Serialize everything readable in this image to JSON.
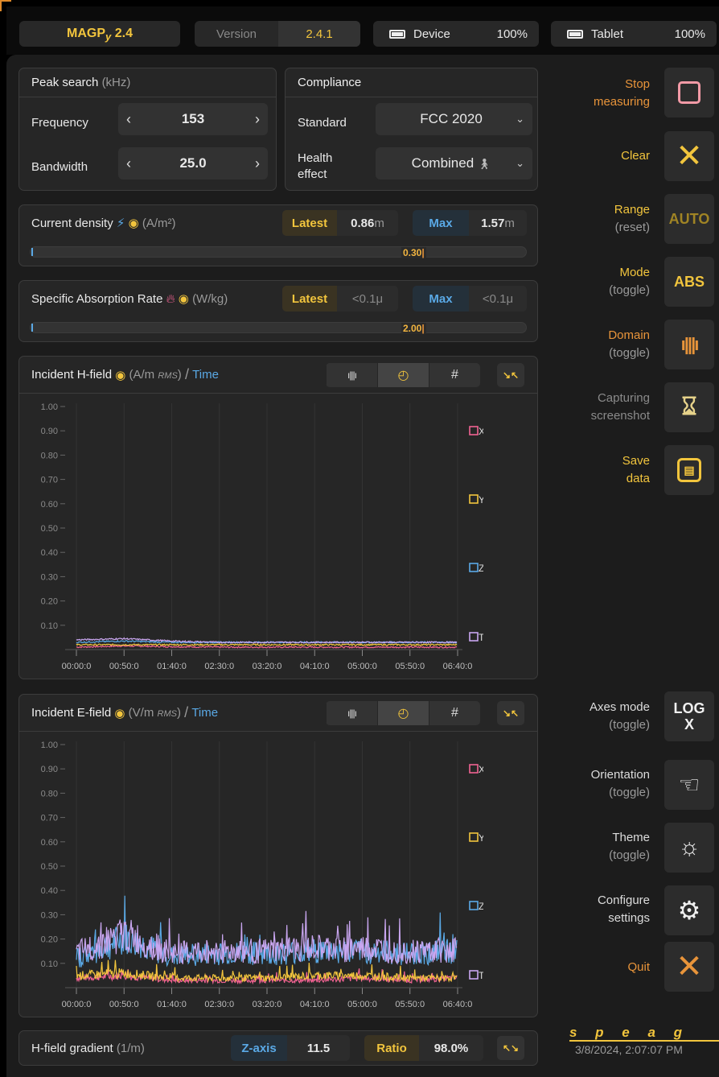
{
  "topbar": {
    "app_name": "MAGPy 2.4",
    "app_name_main": "MAGP",
    "app_name_sub": "y",
    "app_name_ver": "2.4",
    "version_label": "Version",
    "version_value": "2.4.1",
    "device_label": "Device",
    "device_battery": "100%",
    "tablet_label": "Tablet",
    "tablet_battery": "100%"
  },
  "peak_search": {
    "title": "Peak search",
    "unit": "(kHz)",
    "frequency_label": "Frequency",
    "frequency_value": "153",
    "bandwidth_label": "Bandwidth",
    "bandwidth_value": "25.0"
  },
  "compliance": {
    "title": "Compliance",
    "standard_label": "Standard",
    "standard_value": "FCC 2020",
    "health_label_1": "Health",
    "health_label_2": "effect",
    "health_value": "Combined"
  },
  "current_density": {
    "title": "Current density",
    "unit": "(A/m²)",
    "latest_label": "Latest",
    "latest_value": "0.86",
    "latest_suffix": "m",
    "max_label": "Max",
    "max_value": "1.57",
    "max_suffix": "m",
    "limit_value": "0.30",
    "level_fraction": 0.0
  },
  "sar": {
    "title": "Specific Absorption Rate",
    "unit": "(W/kg)",
    "latest_label": "Latest",
    "latest_value": "<0.1μ",
    "max_label": "Max",
    "max_value": "<0.1μ",
    "limit_value": "2.00",
    "level_fraction": 0.0
  },
  "h_field": {
    "title": "Incident H-field",
    "unit_open": "(A/m",
    "unit_rms": "RMS",
    "unit_close": ")",
    "slash": "/",
    "mode": "Time"
  },
  "e_field": {
    "title": "Incident E-field",
    "unit_open": "(V/m",
    "unit_rms": "RMS",
    "unit_close": ")",
    "slash": "/",
    "mode": "Time"
  },
  "view_buttons": {
    "hash": "#"
  },
  "gradient": {
    "title": "H-field gradient",
    "unit": "(1/m)",
    "zaxis_label": "Z-axis",
    "zaxis_value": "11.5",
    "ratio_label": "Ratio",
    "ratio_value": "98.0%"
  },
  "right_panel": {
    "stop_1": "Stop",
    "stop_2": "measuring",
    "clear": "Clear",
    "range_1": "Range",
    "range_2": "(reset)",
    "range_button": "AUTO",
    "mode_1": "Mode",
    "mode_2": "(toggle)",
    "mode_button": "ABS",
    "domain_1": "Domain",
    "domain_2": "(toggle)",
    "capture_1": "Capturing",
    "capture_2": "screenshot",
    "save_1": "Save",
    "save_2": "data",
    "axes_1": "Axes mode",
    "axes_2": "(toggle)",
    "axes_button_1": "LOG",
    "axes_button_2": "X",
    "orient_1": "Orientation",
    "orient_2": "(toggle)",
    "theme_1": "Theme",
    "theme_2": "(toggle)",
    "config_1": "Configure",
    "config_2": "settings",
    "quit": "Quit"
  },
  "footer": {
    "logo": "s p e a g",
    "timestamp": "3/8/2024, 2:07:07 PM"
  },
  "colors": {
    "x": "#f06292",
    "y": "#f2c53d",
    "z": "#5aa9e6",
    "total": "#c9a6f0",
    "accent": "#f2c53d",
    "blue": "#5aa9e6",
    "orange": "#e8943a"
  },
  "chart_data": [
    {
      "type": "line",
      "title": "Incident H-field (A/m RMS) / Time",
      "ylim": [
        0,
        1.0
      ],
      "yticks": [
        "1.00",
        "0.90",
        "0.80",
        "0.70",
        "0.60",
        "0.50",
        "0.40",
        "0.30",
        "0.20",
        "0.10"
      ],
      "xticks": [
        "00:00:0",
        "00:50:0",
        "01:40:0",
        "02:30:0",
        "03:20:0",
        "04:10:0",
        "05:00:0",
        "05:50:0",
        "06:40:0"
      ],
      "legend": [
        "X",
        "Y",
        "Z",
        "Total"
      ],
      "series": [
        {
          "name": "X",
          "values": [
            0.01,
            0.015,
            0.012,
            0.01,
            0.01,
            0.01,
            0.01,
            0.01,
            0.01
          ]
        },
        {
          "name": "Y",
          "values": [
            0.02,
            0.02,
            0.02,
            0.02,
            0.02,
            0.02,
            0.02,
            0.02,
            0.02
          ]
        },
        {
          "name": "Z",
          "values": [
            0.03,
            0.035,
            0.03,
            0.03,
            0.03,
            0.03,
            0.03,
            0.03,
            0.03
          ]
        },
        {
          "name": "Total",
          "values": [
            0.04,
            0.045,
            0.035,
            0.03,
            0.03,
            0.03,
            0.03,
            0.03,
            0.03
          ]
        }
      ]
    },
    {
      "type": "line",
      "title": "Incident E-field (V/m RMS) / Time",
      "ylim": [
        0,
        1.0
      ],
      "yticks": [
        "1.00",
        "0.90",
        "0.80",
        "0.70",
        "0.60",
        "0.50",
        "0.40",
        "0.30",
        "0.20",
        "0.10"
      ],
      "xticks": [
        "00:00:0",
        "00:50:0",
        "01:40:0",
        "02:30:0",
        "03:20:0",
        "04:10:0",
        "05:00:0",
        "05:50:0",
        "06:40:0"
      ],
      "legend": [
        "X",
        "Y",
        "Z",
        "Total"
      ],
      "series": [
        {
          "name": "X",
          "values": [
            0.04,
            0.05,
            0.03,
            0.03,
            0.03,
            0.03,
            0.04,
            0.03,
            0.04
          ]
        },
        {
          "name": "Y",
          "values": [
            0.05,
            0.06,
            0.04,
            0.04,
            0.04,
            0.05,
            0.05,
            0.04,
            0.04
          ]
        },
        {
          "name": "Z",
          "values": [
            0.12,
            0.2,
            0.13,
            0.14,
            0.14,
            0.15,
            0.15,
            0.14,
            0.15
          ]
        },
        {
          "name": "Total",
          "values": [
            0.14,
            0.22,
            0.14,
            0.15,
            0.15,
            0.16,
            0.16,
            0.15,
            0.16
          ]
        }
      ]
    }
  ]
}
